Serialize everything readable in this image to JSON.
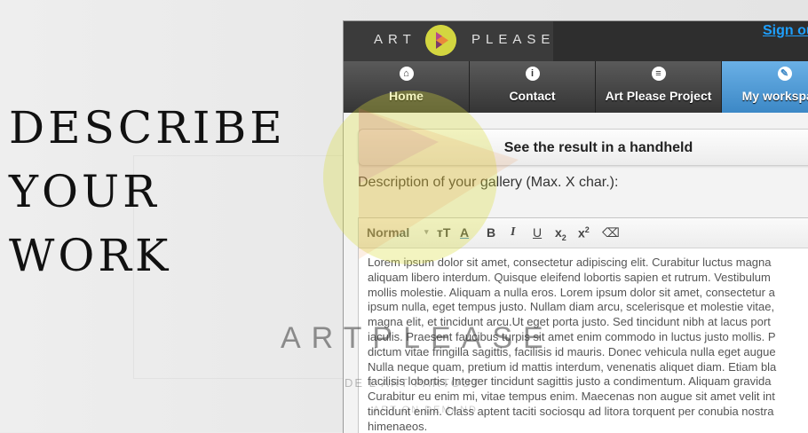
{
  "hero": {
    "line1": "DESCRIBE",
    "line2": "YOUR",
    "line3": "WORK"
  },
  "watermark": {
    "text": "ARTPLEASE",
    "sub1": "DE L'ART PARTOUT",
    "sub2": "ART ON DEMAND"
  },
  "app": {
    "logo": {
      "left": "ART",
      "right": "PLEASE"
    },
    "signout": "Sign out",
    "nav": [
      {
        "label": "Home",
        "icon": "home-icon",
        "glyph": "⌂",
        "active": false
      },
      {
        "label": "Contact",
        "icon": "info-icon",
        "glyph": "i",
        "active": false
      },
      {
        "label": "Art Please Project",
        "icon": "menu-icon",
        "glyph": "≡",
        "active": false
      },
      {
        "label": "My workspace",
        "icon": "pencil-icon",
        "glyph": "✎",
        "active": true
      }
    ],
    "result_button": "See the result in a handheld",
    "description_label": "Description of your gallery (Max. X char.):",
    "toolbar": {
      "format": "Normal",
      "caret": "▾",
      "font_size": "тT",
      "font_color": "A",
      "bold": "B",
      "italic": "I",
      "underline": "U",
      "subscript": "x",
      "sub_mark": "2",
      "superscript": "x",
      "sup_mark": "2",
      "clear_format": "⌫"
    },
    "content_lines": [
      "Lorem ipsum dolor sit amet, consectetur adipiscing elit. Curabitur luctus magna",
      "aliquam libero interdum. Quisque eleifend lobortis sapien et rutrum. Vestibulum",
      "mollis molestie. Aliquam a nulla eros. Lorem ipsum dolor sit amet, consectetur a",
      "ipsum nulla, eget tempus justo. Nullam diam arcu, scelerisque et molestie vitae,",
      "magna elit, et tincidunt arcu.Ut eget porta justo. Sed tincidunt nibh at lacus port",
      "iaculis. Praesent faucibus turpis sit amet enim commodo in luctus justo mollis. P",
      "dictum vitae fringilla sagittis, facilisis id mauris. Donec vehicula nulla eget augue",
      "Nulla neque quam, pretium id mattis interdum, venenatis aliquet diam. Etiam bla",
      "facilisis lobortis. Integer tincidunt sagittis justo a condimentum. Aliquam gravida",
      "Curabitur eu enim mi, vitae tempus enim. Maecenas non augue sit amet velit int",
      "tincidunt enim. Class aptent taciti sociosqu ad litora torquent per conubia nostra",
      "himenaeos."
    ]
  },
  "colors": {
    "accent_blue": "#3c88c6",
    "logo_yellow": "#c9cc3a",
    "logo_orange": "#e98a3a",
    "signout_link": "#1ea0ff"
  }
}
